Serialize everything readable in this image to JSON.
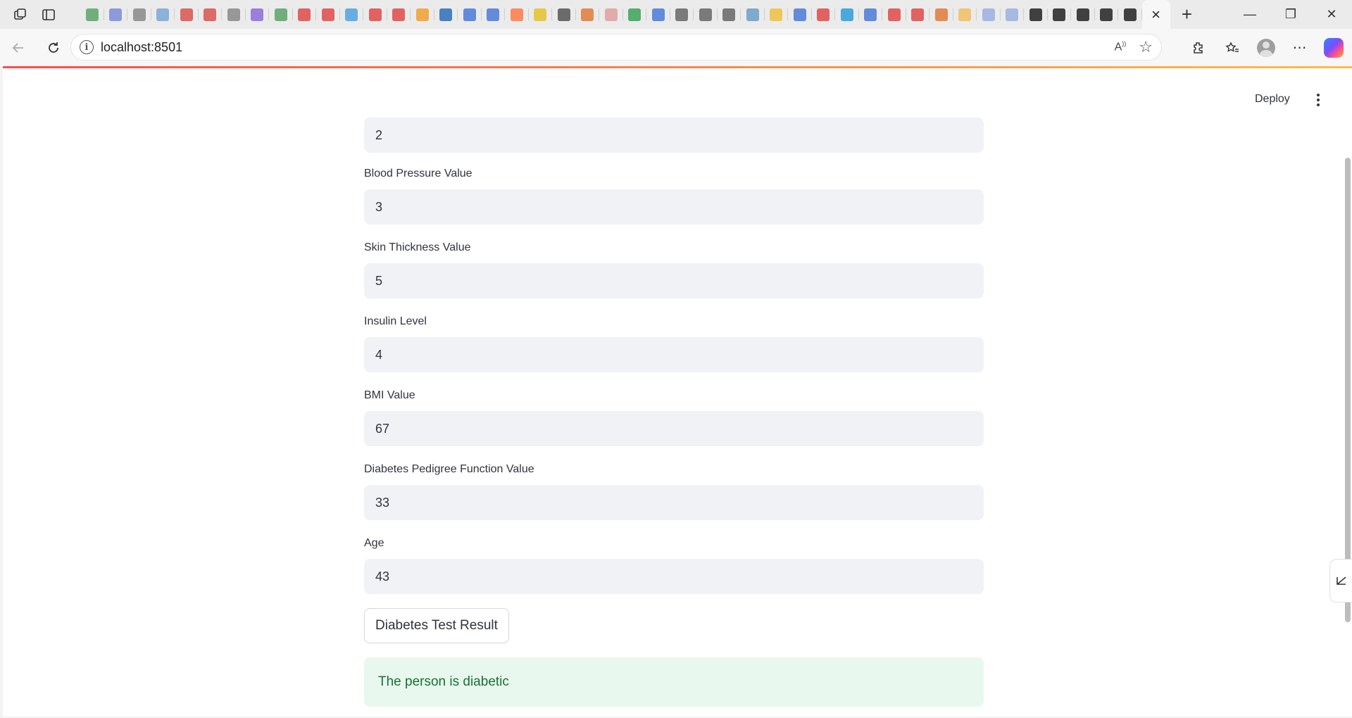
{
  "browser": {
    "url": "localhost:8501",
    "favicon_colors": [
      "#5aa469",
      "#7b8cd6",
      "#888888",
      "#7ba7d8",
      "#d9534f",
      "#d9534f",
      "#888888",
      "#8e6bd8",
      "#5aa469",
      "#e04a4a",
      "#e04a4a",
      "#4fa3e0",
      "#e04a4a",
      "#e04a4a",
      "#f0a030",
      "#2c6fb7",
      "#4a7ad8",
      "#4a7ad8",
      "#ff7a45",
      "#e6c229",
      "#555555",
      "#e07b39",
      "#e0a0a0",
      "#3aa357",
      "#4a7ad8",
      "#666666",
      "#666666",
      "#666666",
      "#6aa0c8",
      "#f0c040",
      "#4a7ad8",
      "#e04a4a",
      "#2d9cdb",
      "#4a7ad8",
      "#e04a4a",
      "#e04a4a",
      "#e07b39",
      "#f0c060",
      "#9ab0e0",
      "#9ab0e0",
      "#222222",
      "#222222",
      "#222222",
      "#222222",
      "#222222"
    ]
  },
  "header": {
    "deploy_label": "Deploy"
  },
  "form": {
    "top_value": "2",
    "fields": [
      {
        "label": "Blood Pressure Value",
        "value": "3"
      },
      {
        "label": "Skin Thickness Value",
        "value": "5"
      },
      {
        "label": "Insulin Level",
        "value": "4"
      },
      {
        "label": "BMI Value",
        "value": "67"
      },
      {
        "label": "Diabetes Pedigree Function Value",
        "value": "33"
      },
      {
        "label": "Age",
        "value": "43"
      }
    ],
    "button_label": "Diabetes Test Result",
    "result_text": "The person is diabetic"
  }
}
